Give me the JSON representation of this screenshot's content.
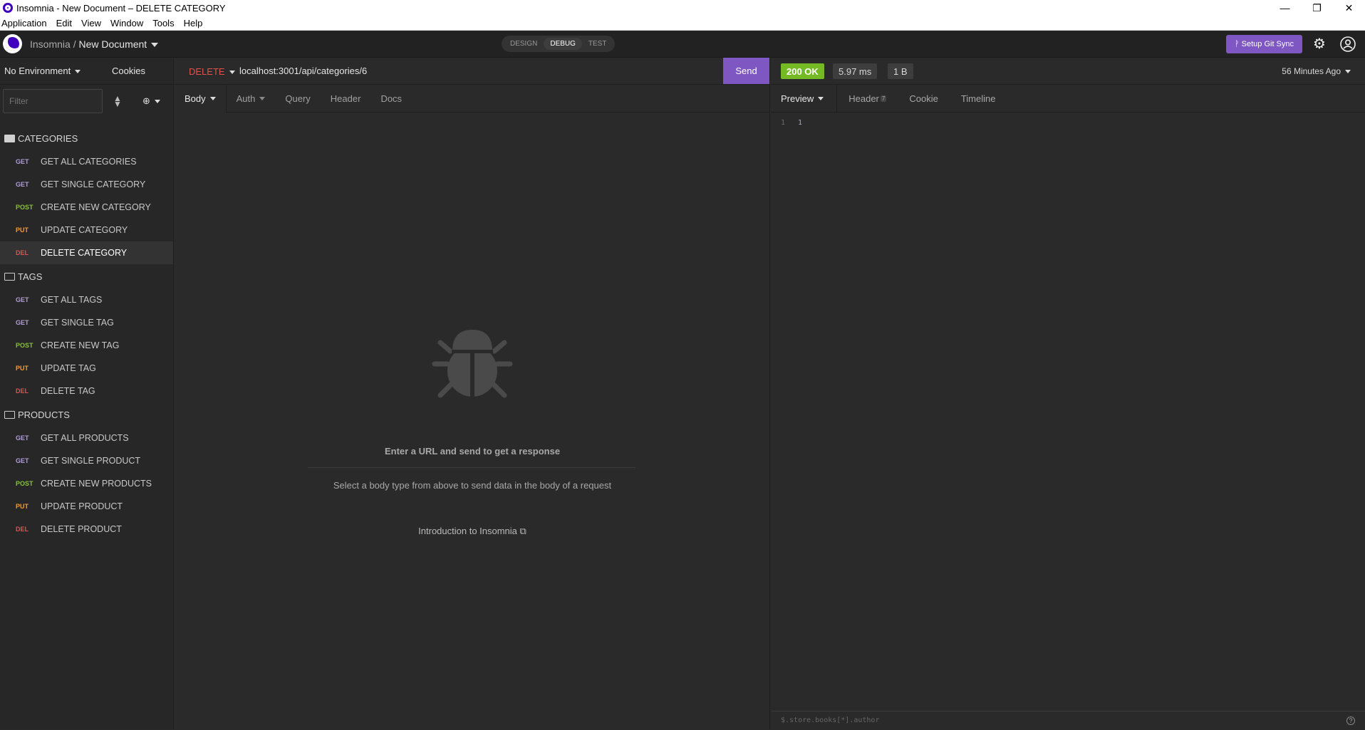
{
  "window": {
    "title": "Insomnia - New Document – DELETE CATEGORY",
    "controls": {
      "minimize": "—",
      "maximize": "❐",
      "close": "✕"
    }
  },
  "menu": [
    "Application",
    "Edit",
    "View",
    "Window",
    "Tools",
    "Help"
  ],
  "header": {
    "workspace": "Insomnia",
    "separator": "/",
    "document": "New Document",
    "modes": [
      "DESIGN",
      "DEBUG",
      "TEST"
    ],
    "active_mode": "DEBUG",
    "git_sync_label": "ᚹ Setup Git Sync",
    "settings_icon": "gear-icon",
    "account_icon": "account-icon"
  },
  "sidebar": {
    "environment": "No Environment",
    "cookies_label": "Cookies",
    "filter_placeholder": "Filter",
    "folders": [
      {
        "name": "CATEGORIES",
        "open": true,
        "requests": [
          {
            "method": "GET",
            "cls": "get",
            "name": "GET ALL CATEGORIES"
          },
          {
            "method": "GET",
            "cls": "get",
            "name": "GET SINGLE CATEGORY"
          },
          {
            "method": "POST",
            "cls": "post",
            "name": "CREATE NEW CATEGORY"
          },
          {
            "method": "PUT",
            "cls": "put",
            "name": "UPDATE CATEGORY"
          },
          {
            "method": "DEL",
            "cls": "del",
            "name": "DELETE CATEGORY",
            "active": true
          }
        ]
      },
      {
        "name": "TAGS",
        "open": false,
        "requests": [
          {
            "method": "GET",
            "cls": "get",
            "name": "GET ALL TAGS"
          },
          {
            "method": "GET",
            "cls": "get",
            "name": "GET SINGLE TAG"
          },
          {
            "method": "POST",
            "cls": "post",
            "name": "CREATE NEW TAG"
          },
          {
            "method": "PUT",
            "cls": "put",
            "name": "UPDATE TAG"
          },
          {
            "method": "DEL",
            "cls": "del",
            "name": "DELETE TAG"
          }
        ]
      },
      {
        "name": "PRODUCTS",
        "open": false,
        "requests": [
          {
            "method": "GET",
            "cls": "get",
            "name": "GET ALL PRODUCTS"
          },
          {
            "method": "GET",
            "cls": "get",
            "name": "GET SINGLE PRODUCT"
          },
          {
            "method": "POST",
            "cls": "post",
            "name": "CREATE NEW PRODUCTS"
          },
          {
            "method": "PUT",
            "cls": "put",
            "name": "UPDATE PRODUCT"
          },
          {
            "method": "DEL",
            "cls": "del",
            "name": "DELETE PRODUCT"
          }
        ]
      }
    ]
  },
  "request": {
    "method": "DELETE",
    "url": "localhost:3001/api/categories/6",
    "send_label": "Send",
    "tabs": [
      "Body",
      "Auth",
      "Query",
      "Header",
      "Docs"
    ],
    "active_tab": "Body",
    "empty_title": "Enter a URL and send to get a response",
    "empty_hint": "Select a body type from above to send data in the body of a request",
    "intro_link": "Introduction to Insomnia"
  },
  "response": {
    "status": "200 OK",
    "time": "5.97 ms",
    "size": "1 B",
    "ago": "56 Minutes Ago",
    "tabs": [
      "Preview",
      "Header",
      "Cookie",
      "Timeline"
    ],
    "active_tab": "Preview",
    "header_count": "7",
    "body_line_number": "1",
    "body_value": "1",
    "filter_placeholder": "$.store.books[*].author",
    "help_label": "?"
  },
  "colors": {
    "accent": "#7e57c2",
    "status_ok": "#75ba24",
    "get": "#b19cd9",
    "post": "#86c42f",
    "put": "#ff9a1f",
    "delete": "#e0524d"
  }
}
